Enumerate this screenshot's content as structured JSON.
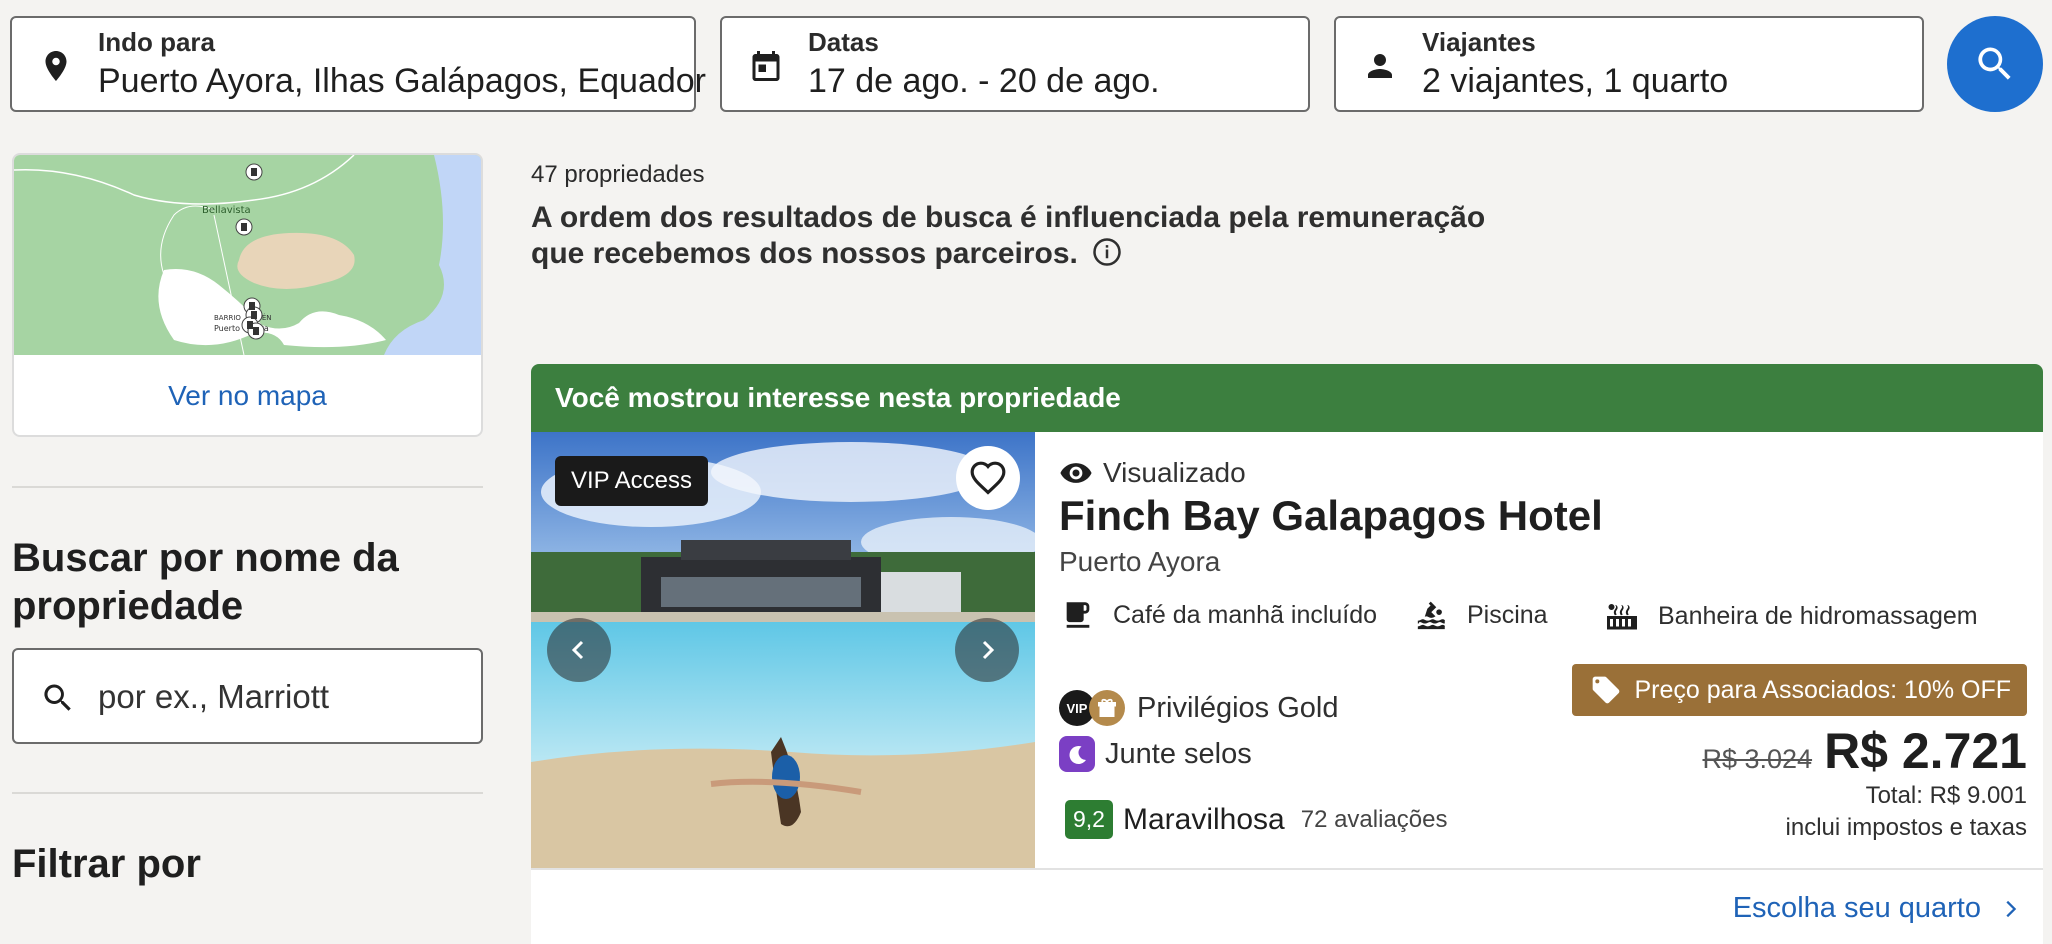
{
  "search": {
    "destination": {
      "label": "Indo para",
      "value": "Puerto Ayora, Ilhas Galápagos, Equador",
      "icon": "location-pin-icon"
    },
    "dates": {
      "label": "Datas",
      "value": "17 de ago. - 20 de ago.",
      "icon": "calendar-icon"
    },
    "travelers": {
      "label": "Viajantes",
      "value": "2 viajantes, 1 quarto",
      "icon": "person-icon"
    },
    "button_icon": "search-icon",
    "accent": "#1e6fcf"
  },
  "map": {
    "link_label": "Ver no mapa",
    "labels": [
      "Bellavista",
      "BARRIO",
      "EDÉN",
      "Puerto",
      "Ayora"
    ]
  },
  "sidebar": {
    "name_search_heading": "Buscar por nome da propriedade",
    "name_search_placeholder": "por ex., Marriott",
    "filter_heading": "Filtrar por"
  },
  "results": {
    "count": "47 propriedades",
    "notice": "A ordem dos resultados de busca é influenciada pela remuneração que recebemos dos nossos parceiros."
  },
  "property": {
    "banner": "Você mostrou interesse nesta propriedade",
    "banner_color": "#3c7f3f",
    "vip_tag": "VIP Access",
    "viewed": "Visualizado",
    "name": "Finch Bay Galapagos Hotel",
    "city": "Puerto Ayora",
    "amenities": [
      {
        "label": "Café da manhã incluído",
        "icon": "breakfast-icon"
      },
      {
        "label": "Piscina",
        "icon": "pool-icon"
      },
      {
        "label": "Banheira de hidromassagem",
        "icon": "hot-tub-icon"
      }
    ],
    "vip_badge": "VIP",
    "loyalty": "Privilégios Gold",
    "stamps": "Junte selos",
    "rating_score": "9,2",
    "rating_label": "Maravilhosa",
    "reviews": "72 avaliações",
    "promo": "Preço para Associados: 10% OFF",
    "old_price": "R$ 3.024",
    "price": "R$ 2.721",
    "total": "Total: R$ 9.001",
    "taxes": "inclui impostos e taxas",
    "choose_room": "Escolha seu quarto"
  }
}
